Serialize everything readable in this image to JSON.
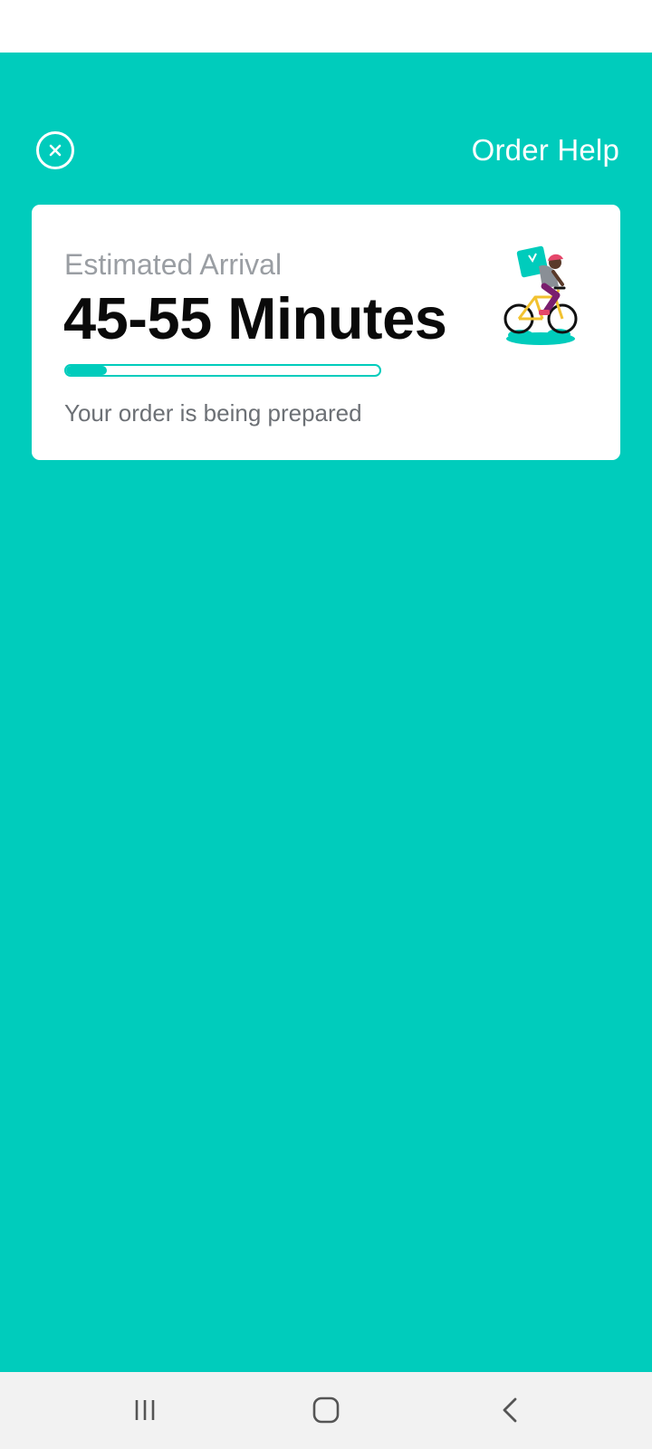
{
  "header": {
    "close_icon": "close-circle-icon",
    "help_label": "Order Help"
  },
  "eta_card": {
    "label": "Estimated Arrival",
    "value": "45-55 Minutes",
    "progress": 0.13,
    "status": "Your order is being prepared",
    "illustration": "rider-on-bicycle-icon"
  },
  "navigation": {
    "recents_icon": "recent-apps-icon",
    "home_icon": "home-icon",
    "back_icon": "back-icon"
  },
  "colors": {
    "accent": "#00CCBC",
    "card_background": "#ffffff",
    "label_gray": "#9a9ea3",
    "nav_background": "#f2f2f2"
  }
}
